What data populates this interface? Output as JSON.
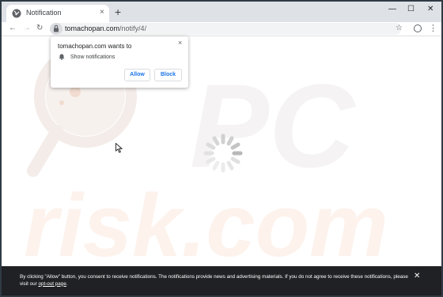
{
  "tab": {
    "title": "Notification",
    "close_icon": "×",
    "new_tab_icon": "+"
  },
  "window_controls": {
    "minimize": "—",
    "maximize": "☐",
    "close": "✕"
  },
  "toolbar": {
    "back_icon": "←",
    "forward_icon": "→",
    "reload_icon": "↻",
    "url_domain": "tomachopan.com",
    "url_path": "/notify/4/",
    "star_icon": "☆",
    "menu_icon": "⋮"
  },
  "popup": {
    "title": "tomachopan.com wants to",
    "permission": "Show notifications",
    "allow": "Allow",
    "block": "Block",
    "close_icon": "×"
  },
  "banner": {
    "text": "By clicking \"Allow\" button, you consent to receive notifications. The notifications provide news and advertising materials. If you do not agree to receive these notifications, please visit our ",
    "link": "opt-out page",
    "suffix": ".",
    "close_icon": "✕"
  },
  "watermark": {
    "line1": "PC",
    "line2": "risk.com"
  },
  "colors": {
    "accent": "#1a73e8",
    "banner_bg": "#202124",
    "watermark": "#fbe8dc"
  }
}
